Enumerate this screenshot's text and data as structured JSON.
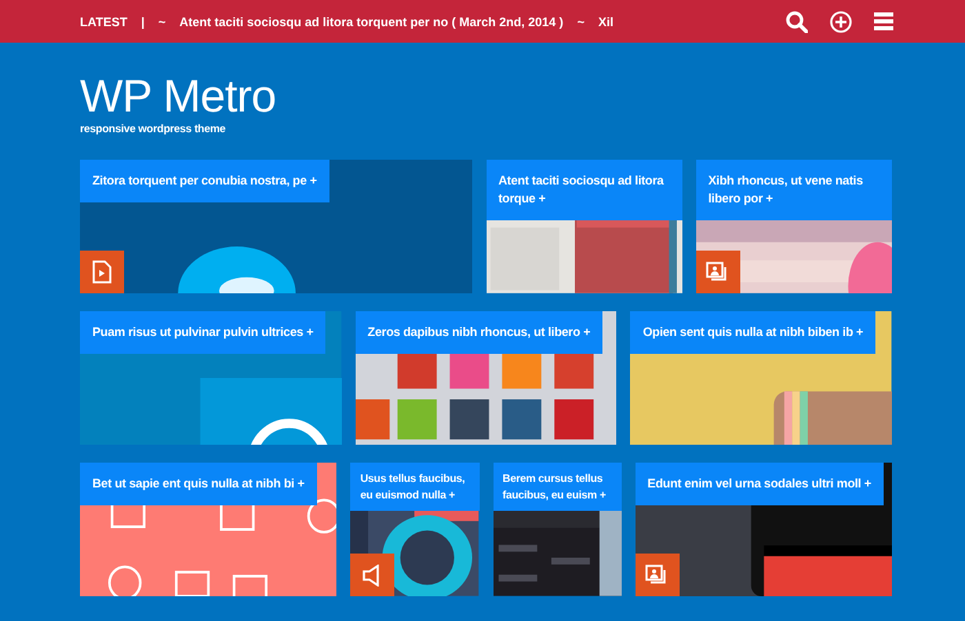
{
  "topbar": {
    "label": "LATEST",
    "separator": "|",
    "dash_before": "~",
    "headline": "Atent taciti sociosqu ad litora torquent per no ( March 2nd, 2014 )",
    "dash_after": "~",
    "next": "Xil"
  },
  "site": {
    "title": "WP Metro",
    "tagline": "responsive wordpress theme"
  },
  "rows": [
    {
      "tiles": [
        {
          "caption": "Zitora torquent per conubia nostra, pe +",
          "kind": "video"
        },
        {
          "caption": "Atent taciti sociosqu ad litora torque +",
          "kind": "plain"
        },
        {
          "caption": "Xibh rhoncus, ut vene natis libero por +",
          "kind": "gallery"
        }
      ]
    },
    {
      "tiles": [
        {
          "caption": "Puam risus ut pulvinar pulvin ultrices +",
          "kind": "plain"
        },
        {
          "caption": "Zeros dapibus nibh rhoncus, ut libero +",
          "kind": "plain"
        },
        {
          "caption": "Opien sent quis nulla at nibh biben ib +",
          "kind": "plain"
        }
      ]
    },
    {
      "tiles": [
        {
          "caption": "Bet ut sapie ent quis nulla at nibh bi +",
          "kind": "plain"
        },
        {
          "caption": "Usus tellus faucibus, eu euismod nulla +",
          "kind": "audio"
        },
        {
          "caption": "Berem cursus tellus faucibus, eu euism +",
          "kind": "plain"
        },
        {
          "caption": "Edunt enim vel urna sodales ultri moll +",
          "kind": "gallery"
        }
      ]
    }
  ]
}
